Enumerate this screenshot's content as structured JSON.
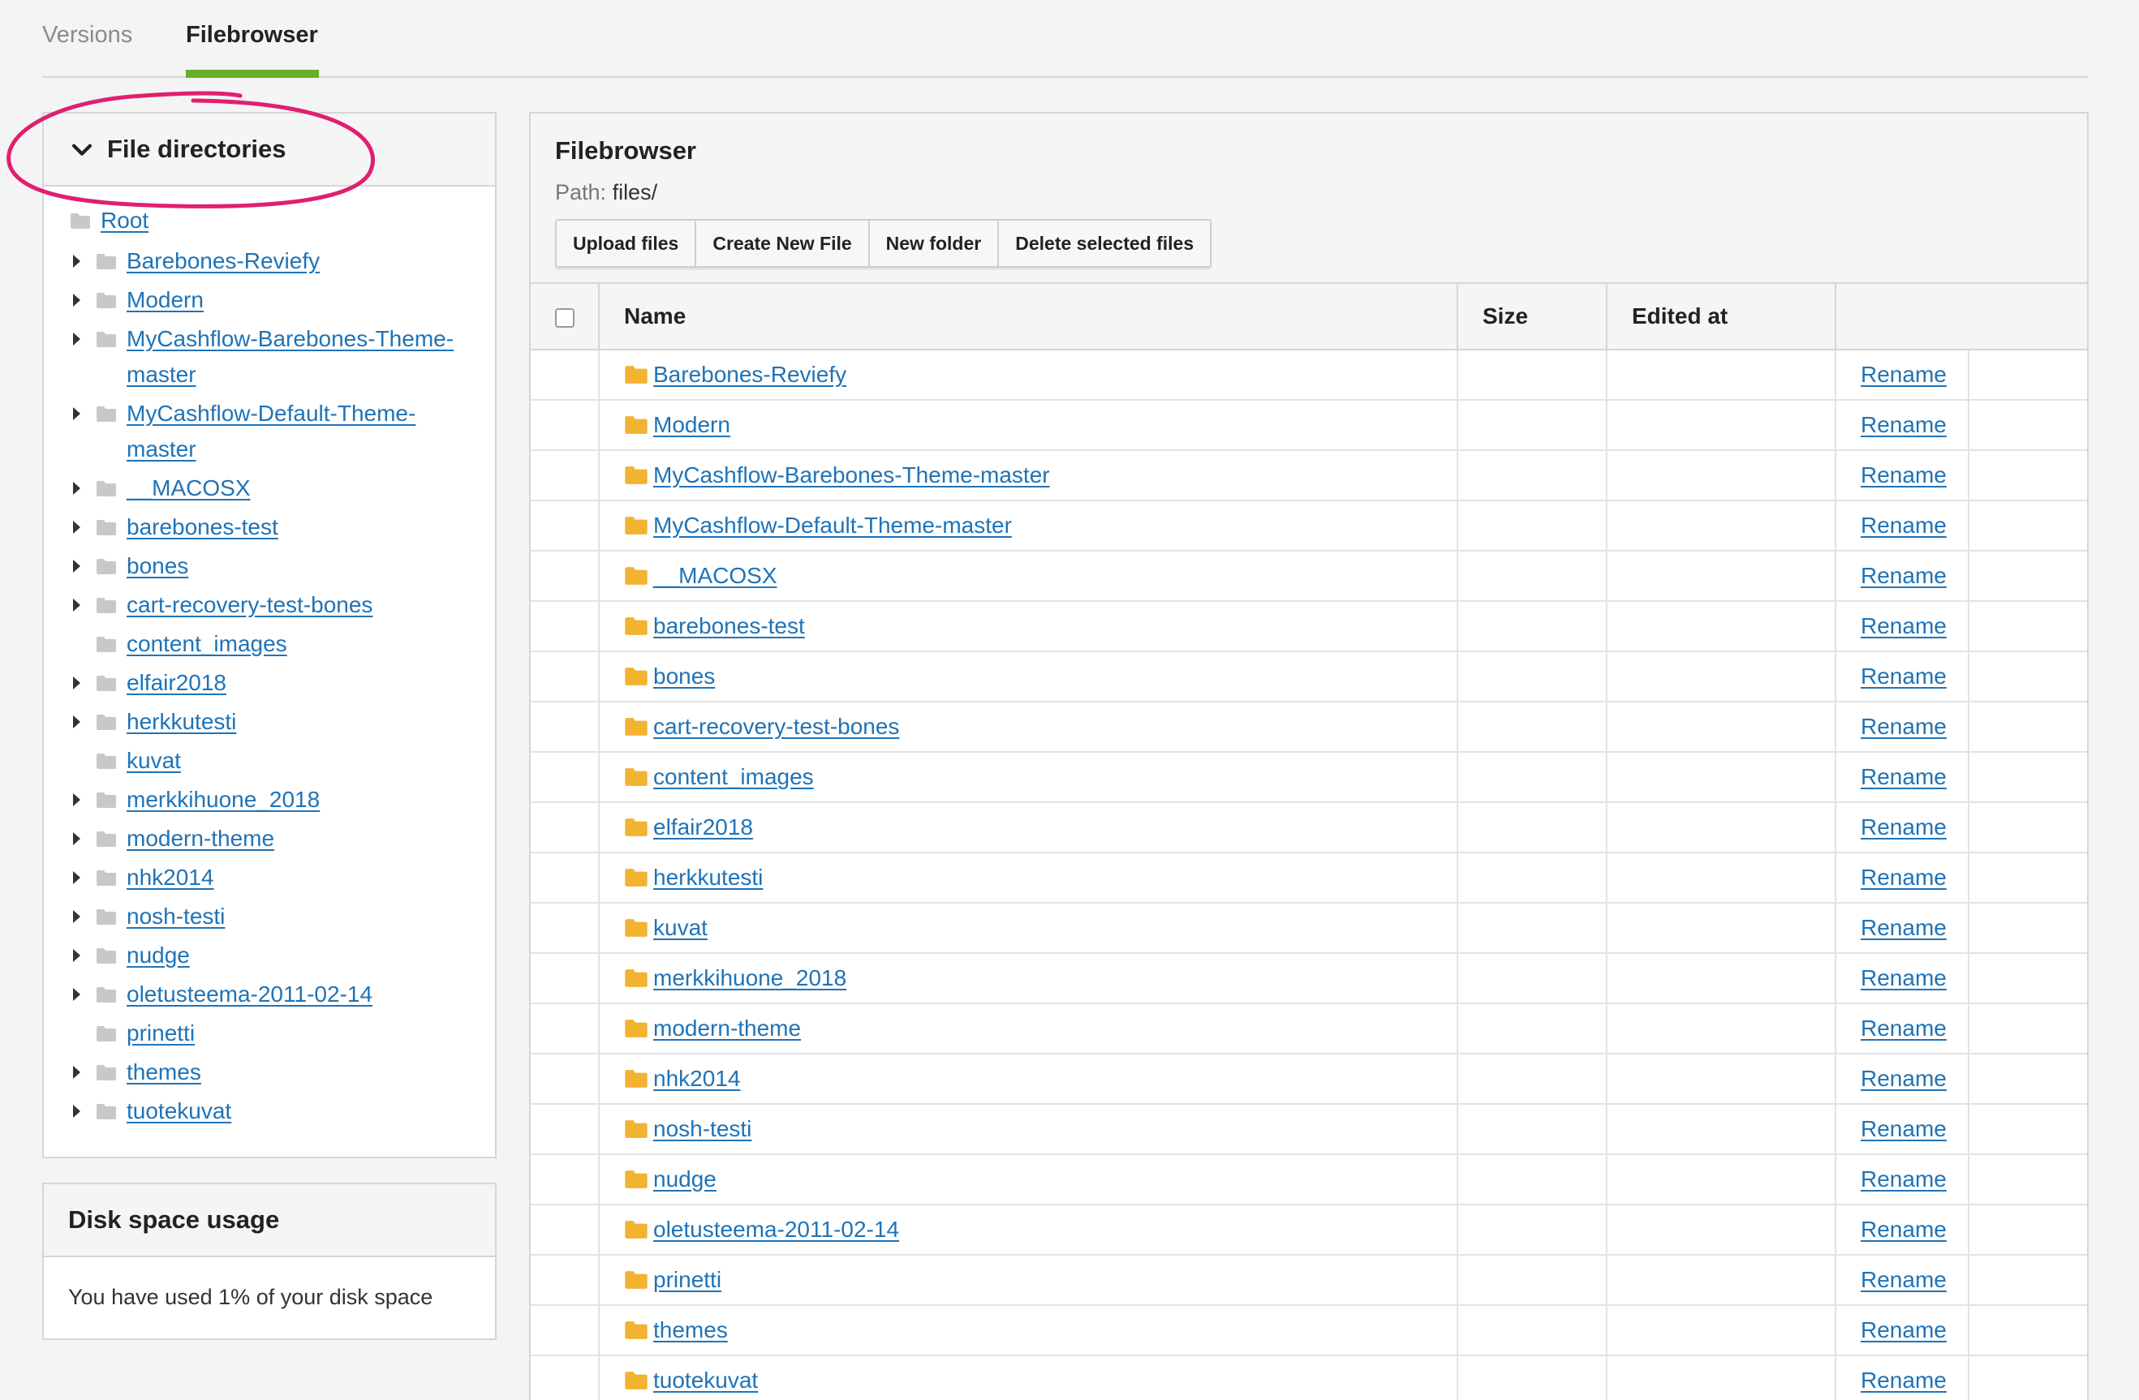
{
  "tabs": [
    {
      "label": "Versions",
      "active": false
    },
    {
      "label": "Filebrowser",
      "active": true
    }
  ],
  "sidebar": {
    "directories_title": "File directories",
    "tree": [
      {
        "label": "Root",
        "expandable": false,
        "root": true
      },
      {
        "label": "Barebones-Reviefy",
        "expandable": true
      },
      {
        "label": "Modern",
        "expandable": true
      },
      {
        "label": "MyCashflow-Barebones-Theme-master",
        "expandable": true
      },
      {
        "label": "MyCashflow-Default-Theme-master",
        "expandable": true
      },
      {
        "label": "__MACOSX",
        "expandable": true
      },
      {
        "label": "barebones-test",
        "expandable": true
      },
      {
        "label": "bones",
        "expandable": true
      },
      {
        "label": "cart-recovery-test-bones",
        "expandable": true
      },
      {
        "label": "content_images",
        "expandable": false
      },
      {
        "label": "elfair2018",
        "expandable": true
      },
      {
        "label": "herkkutesti",
        "expandable": true
      },
      {
        "label": "kuvat",
        "expandable": false
      },
      {
        "label": "merkkihuone_2018",
        "expandable": true
      },
      {
        "label": "modern-theme",
        "expandable": true
      },
      {
        "label": "nhk2014",
        "expandable": true
      },
      {
        "label": "nosh-testi",
        "expandable": true
      },
      {
        "label": "nudge",
        "expandable": true
      },
      {
        "label": "oletusteema-2011-02-14",
        "expandable": true
      },
      {
        "label": "prinetti",
        "expandable": false
      },
      {
        "label": "themes",
        "expandable": true
      },
      {
        "label": "tuotekuvat",
        "expandable": true
      }
    ],
    "disk_title": "Disk space usage",
    "disk_text": "You have used 1% of your disk space"
  },
  "filebrowser": {
    "title": "Filebrowser",
    "path_label": "Path:",
    "path_value": "files/",
    "buttons": {
      "upload": "Upload files",
      "create": "Create New File",
      "new_folder": "New folder",
      "delete": "Delete selected files"
    },
    "columns": {
      "name": "Name",
      "size": "Size",
      "edited": "Edited at"
    },
    "rename_label": "Rename",
    "rows": [
      "Barebones-Reviefy",
      "Modern",
      "MyCashflow-Barebones-Theme-master",
      "MyCashflow-Default-Theme-master",
      "__MACOSX",
      "barebones-test",
      "bones",
      "cart-recovery-test-bones",
      "content_images",
      "elfair2018",
      "herkkutesti",
      "kuvat",
      "merkkihuone_2018",
      "modern-theme",
      "nhk2014",
      "nosh-testi",
      "nudge",
      "oletusteema-2011-02-14",
      "prinetti",
      "themes",
      "tuotekuvat"
    ]
  },
  "colors": {
    "accent_tab": "#6aac2b",
    "link": "#1f73b7",
    "highlight": "#e0206e",
    "folder_yellow": "#f2b330",
    "folder_grey": "#c8c8c8"
  }
}
